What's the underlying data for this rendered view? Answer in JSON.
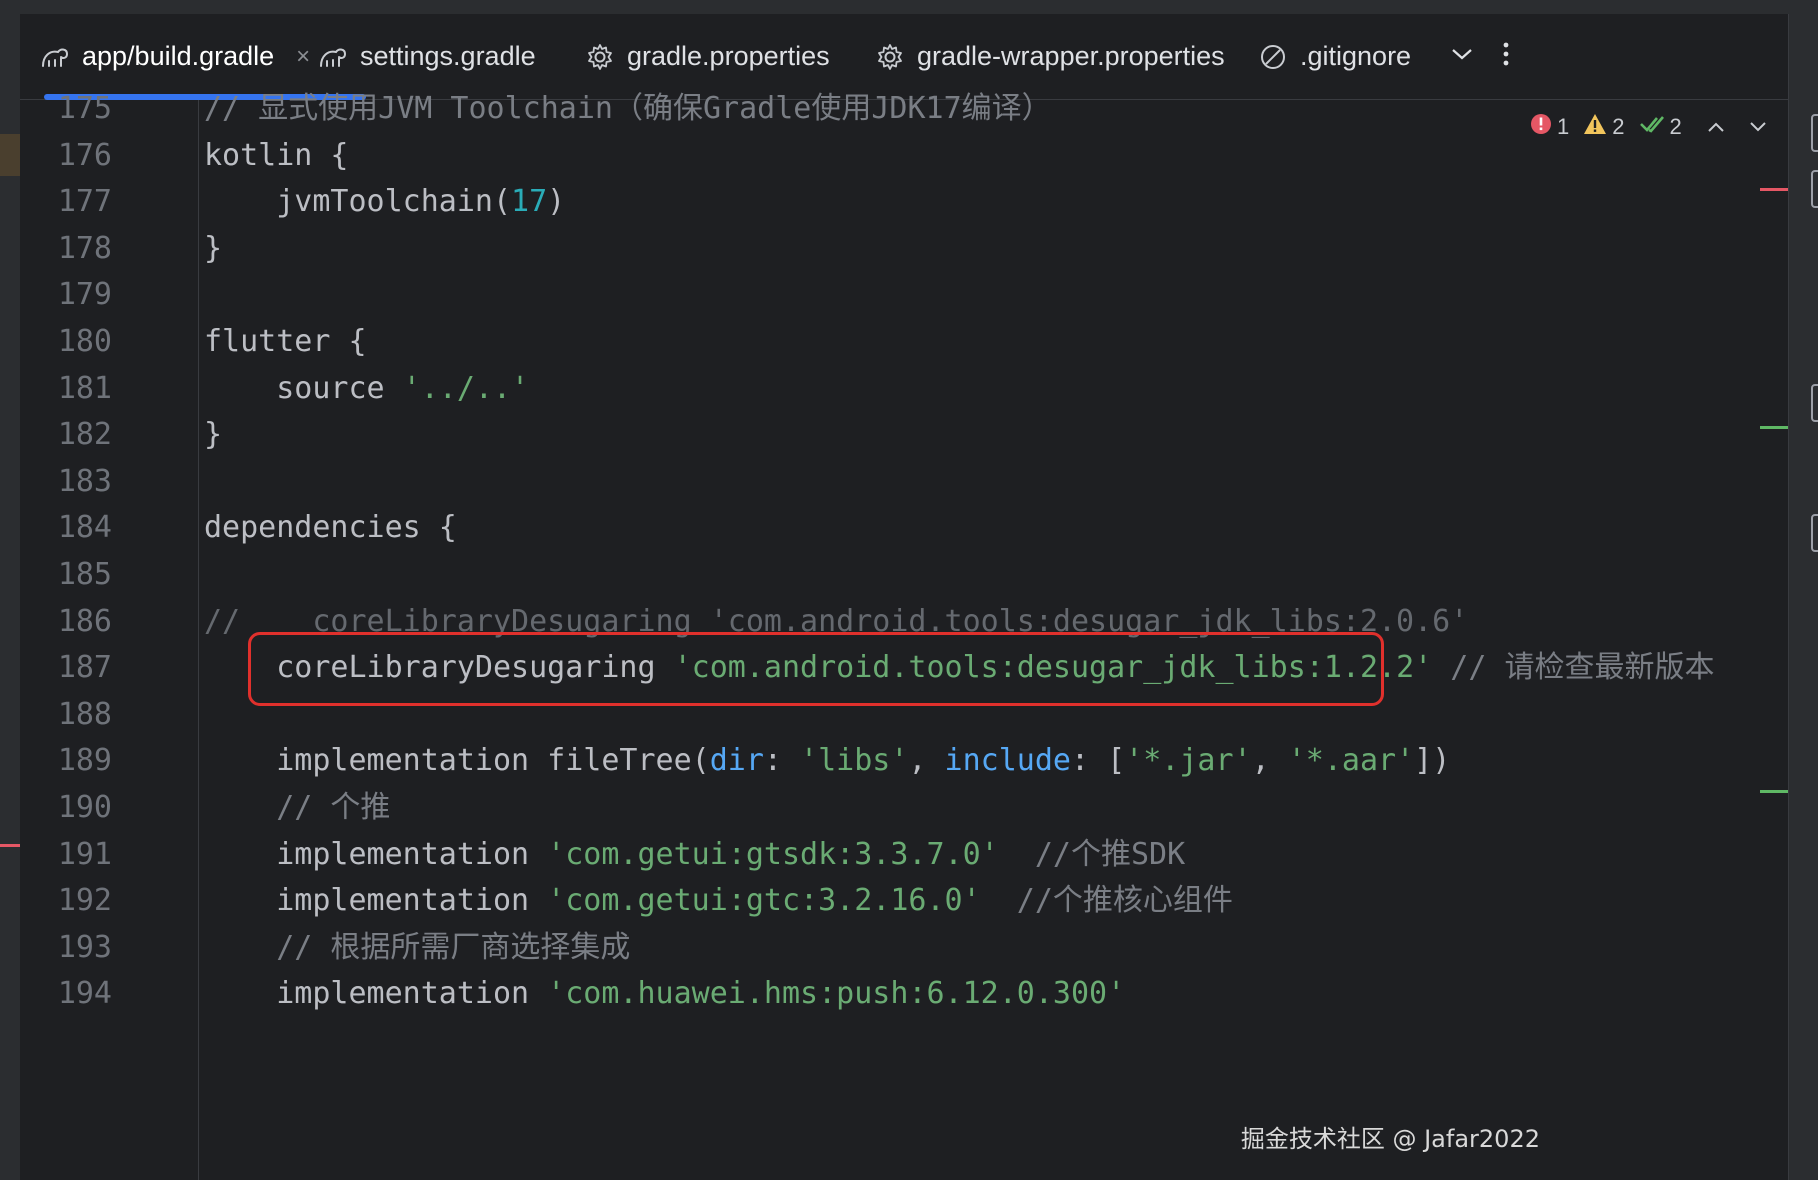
{
  "tabs": [
    {
      "label": "app/build.gradle",
      "icon": "gradle-icon",
      "active": true,
      "close": "×"
    },
    {
      "label": "settings.gradle",
      "icon": "gradle-icon"
    },
    {
      "label": "gradle.properties",
      "icon": "gear-icon"
    },
    {
      "label": "gradle-wrapper.properties",
      "icon": "gear-icon"
    },
    {
      "label": ".gitignore",
      "icon": "ignore-icon"
    }
  ],
  "inspections": {
    "errors": "1",
    "warnings": "2",
    "ok": "2"
  },
  "lines": [
    {
      "num": "175",
      "segments": [
        [
          "cmt",
          "// 显式使用JVM Toolchain（确保Gradle使用JDK17编译）"
        ]
      ]
    },
    {
      "num": "176",
      "segments": [
        [
          "plain",
          "kotlin {"
        ]
      ]
    },
    {
      "num": "177",
      "segments": [
        [
          "plain",
          "    jvmToolchain("
        ],
        [
          "num",
          "17"
        ],
        [
          "plain",
          ")"
        ]
      ]
    },
    {
      "num": "178",
      "segments": [
        [
          "plain",
          "}"
        ]
      ]
    },
    {
      "num": "179",
      "segments": []
    },
    {
      "num": "180",
      "segments": [
        [
          "plain",
          "flutter {"
        ]
      ]
    },
    {
      "num": "181",
      "segments": [
        [
          "plain",
          "    source "
        ],
        [
          "str",
          "'../..'"
        ]
      ]
    },
    {
      "num": "182",
      "segments": [
        [
          "plain",
          "}"
        ]
      ]
    },
    {
      "num": "183",
      "segments": []
    },
    {
      "num": "184",
      "segments": [
        [
          "plain",
          "dependencies {"
        ]
      ]
    },
    {
      "num": "185",
      "segments": []
    },
    {
      "num": "186",
      "segments": [
        [
          "cmt",
          "//    coreLibraryDesugaring 'com.android.tools:desugar_jdk_libs:2.0.6'"
        ]
      ]
    },
    {
      "num": "187",
      "segments": [
        [
          "plain",
          "    coreLibraryDesugaring "
        ],
        [
          "str",
          "'com.android.tools:desugar_jdk_libs:1.2.2'"
        ],
        [
          "cmt",
          " // 请检查最新版本"
        ]
      ]
    },
    {
      "num": "188",
      "segments": []
    },
    {
      "num": "189",
      "segments": [
        [
          "plain",
          "    implementation fileTree("
        ],
        [
          "named",
          "dir"
        ],
        [
          "plain",
          ": "
        ],
        [
          "str",
          "'libs'"
        ],
        [
          "plain",
          ", "
        ],
        [
          "named",
          "include"
        ],
        [
          "plain",
          ": ["
        ],
        [
          "str",
          "'*.jar'"
        ],
        [
          "plain",
          ", "
        ],
        [
          "str",
          "'*.aar'"
        ],
        [
          "plain",
          "])"
        ]
      ]
    },
    {
      "num": "190",
      "segments": [
        [
          "cmt",
          "    // 个推"
        ]
      ]
    },
    {
      "num": "191",
      "segments": [
        [
          "plain",
          "    implementation "
        ],
        [
          "str",
          "'com.getui:gtsdk:3.3.7.0'"
        ],
        [
          "cmt",
          "  //个推SDK"
        ]
      ]
    },
    {
      "num": "192",
      "segments": [
        [
          "plain",
          "    implementation "
        ],
        [
          "str",
          "'com.getui:gtc:3.2.16.0'"
        ],
        [
          "cmt",
          "  //个推核心组件"
        ]
      ]
    },
    {
      "num": "193",
      "segments": [
        [
          "cmt",
          "    // 根据所需厂商选择集成"
        ]
      ]
    },
    {
      "num": "194",
      "segments": [
        [
          "plain",
          "    implementation "
        ],
        [
          "str",
          "'com.huawei.hms:push:6.12.0.300'"
        ]
      ]
    }
  ],
  "watermark": "掘金技术社区 @ Jafar2022",
  "colors": {
    "accent": "#3574f0",
    "error": "#e55765",
    "warning": "#f2c55c",
    "ok": "#5fb865",
    "highlight": "#e0302c"
  }
}
